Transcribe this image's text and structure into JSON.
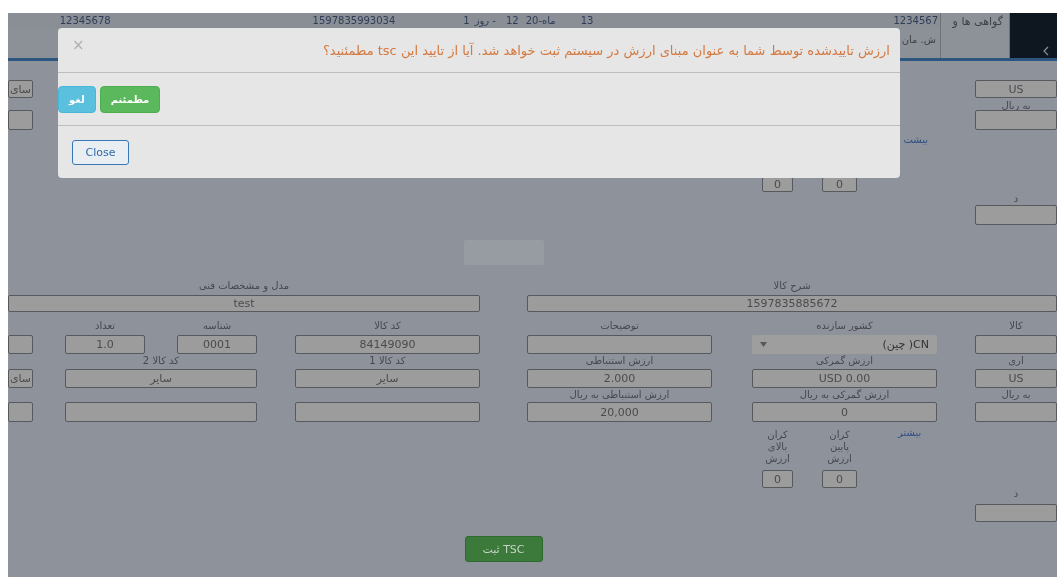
{
  "header_row": {
    "cells": [
      "1234567",
      "13",
      "ماه-20",
      "12",
      "- روز",
      "1",
      "1597835993034",
      "12345678"
    ],
    "column_header": "گواهی ها و",
    "sub_header": "ش. مان"
  },
  "modal": {
    "message": "ارزش تاییدشده توسط شما به عنوان مبنای ارزش در سیستم ثبت خواهد شد. آیا از تایید این tsc مطمئنید؟",
    "close_symbol": "×",
    "actions": [
      {
        "label": "مطمئنم",
        "kind": "confirm"
      },
      {
        "label": "لغو",
        "kind": "cancel"
      }
    ],
    "footer_button": "Close"
  },
  "form_rows": [
    {
      "items": [
        {
          "kind": "field",
          "value": "US"
        },
        {
          "kind": "field",
          "value": "سای"
        }
      ]
    },
    {
      "items": [
        {
          "kind": "label",
          "text": "به ریال"
        }
      ]
    },
    {
      "items": [
        {
          "kind": "field"
        },
        {
          "kind": "field"
        }
      ]
    },
    {
      "items": [
        {
          "kind": "link",
          "text": "بیشت"
        }
      ]
    },
    {
      "items": [
        {
          "kind": "small_field",
          "value": "0"
        },
        {
          "kind": "small_field",
          "value": "0"
        }
      ]
    },
    {
      "items": [
        {
          "kind": "label",
          "text": "د"
        }
      ]
    },
    {
      "items": [
        {
          "kind": "field"
        }
      ]
    },
    {
      "items": [
        {
          "kind": "ghost_button"
        }
      ]
    },
    {
      "items": [
        {
          "kind": "label",
          "text": "شرح کالا"
        },
        {
          "kind": "label",
          "text": "مدل و مشخصات فنی"
        }
      ]
    },
    {
      "items": [
        {
          "kind": "field",
          "value": "1597835885672"
        },
        {
          "kind": "field",
          "value": "test"
        }
      ]
    },
    {
      "items": [
        {
          "kind": "label",
          "text": "کالا"
        },
        {
          "kind": "label",
          "text": "کشور سازنده"
        },
        {
          "kind": "label",
          "text": "توضیحات"
        },
        {
          "kind": "label",
          "text": "کد کالا"
        },
        {
          "kind": "label",
          "text": "شناسه"
        },
        {
          "kind": "label",
          "text": "تعداد"
        }
      ]
    },
    {
      "items": [
        {
          "kind": "field"
        },
        {
          "kind": "select",
          "value": "CN( چین)"
        },
        {
          "kind": "field"
        },
        {
          "kind": "field",
          "value": "84149090"
        },
        {
          "kind": "field",
          "value": "0001"
        },
        {
          "kind": "field",
          "value": "1.0"
        },
        {
          "kind": "field"
        }
      ]
    },
    {
      "items": [
        {
          "kind": "label",
          "text": "اری"
        },
        {
          "kind": "label",
          "text": "ارزش گمرکی"
        },
        {
          "kind": "label",
          "text": "ارزش استنباطی"
        },
        {
          "kind": "label",
          "text": "کد کالا 1"
        },
        {
          "kind": "label",
          "text": "کد کالا 2"
        }
      ]
    },
    {
      "items": [
        {
          "kind": "field",
          "value": "US"
        },
        {
          "kind": "field",
          "value": "USD 0.00"
        },
        {
          "kind": "field",
          "value": "2.000"
        },
        {
          "kind": "field",
          "value": "سایر"
        },
        {
          "kind": "field",
          "value": "سایر"
        },
        {
          "kind": "field",
          "value": "سای"
        }
      ]
    },
    {
      "items": [
        {
          "kind": "label",
          "text": "به ریال"
        },
        {
          "kind": "label",
          "text": "ارزش گمرکی به ریال"
        },
        {
          "kind": "label",
          "text": "ارزش استنباطی به ریال"
        }
      ]
    },
    {
      "items": [
        {
          "kind": "field"
        },
        {
          "kind": "field",
          "value": "0"
        },
        {
          "kind": "field",
          "value": "20,000"
        },
        {
          "kind": "field"
        },
        {
          "kind": "field"
        },
        {
          "kind": "field"
        }
      ]
    },
    {
      "items": [
        {
          "kind": "link",
          "text": "بیشتر"
        },
        {
          "kind": "label",
          "text": "کران پایین ارزش"
        },
        {
          "kind": "label",
          "text": "کران بالای ارزش"
        }
      ]
    },
    {
      "items": [
        {
          "kind": "small_field",
          "value": "0"
        },
        {
          "kind": "small_field",
          "value": "0"
        }
      ]
    },
    {
      "items": [
        {
          "kind": "label",
          "text": "د"
        }
      ]
    },
    {
      "items": [
        {
          "kind": "field"
        }
      ]
    },
    {
      "items": [
        {
          "kind": "submit",
          "label": "ثبت TSC"
        }
      ]
    }
  ]
}
